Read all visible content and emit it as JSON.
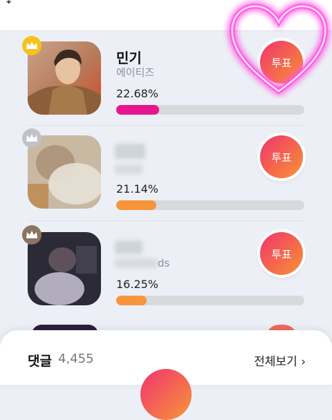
{
  "colors": {
    "accent_pink": "#e6168c",
    "accent_orange": "#f7953d",
    "gold": "#f4c21a",
    "silver": "#bfc2c8",
    "bronze": "#8b7460"
  },
  "ranking": [
    {
      "rank": 1,
      "name": "민기",
      "group": "에이티즈",
      "percent_label": "22.68%",
      "percent": 0.2268,
      "bar_color": "#e6168c",
      "crown_color": "#f4c21a",
      "vote_label": "투표"
    },
    {
      "rank": 2,
      "name": "",
      "group": "",
      "percent_label": "21.14%",
      "percent": 0.2114,
      "bar_color": "#f7953d",
      "crown_color": "#bfc2c8",
      "vote_label": "투표"
    },
    {
      "rank": 3,
      "name": "",
      "group": "ds",
      "percent_label": "16.25%",
      "percent": 0.1625,
      "bar_color": "#f7953d",
      "crown_color": "#8b7460",
      "vote_label": "투표"
    }
  ],
  "comments": {
    "label": "댓글",
    "count": "4,455",
    "view_all": "전체보기 ›"
  },
  "icons": {
    "crown": "crown-icon",
    "heart": "neon-heart-icon"
  }
}
